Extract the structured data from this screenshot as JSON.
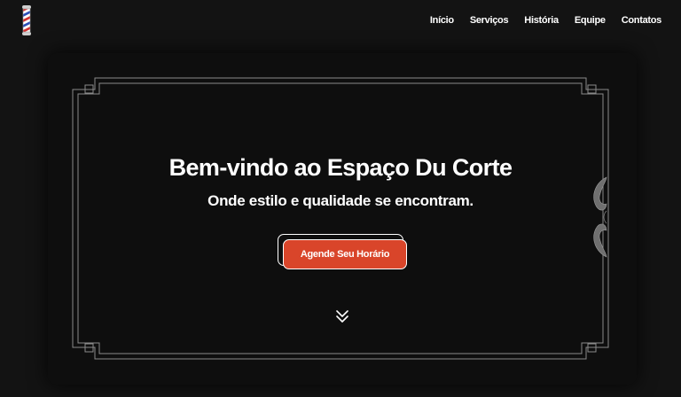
{
  "nav": {
    "logo_icon": "barber-pole-icon",
    "links": [
      {
        "label": "Início"
      },
      {
        "label": "Serviços"
      },
      {
        "label": "História"
      },
      {
        "label": "Equipe"
      },
      {
        "label": "Contatos"
      }
    ]
  },
  "hero": {
    "title": "Bem-vindo ao Espaço Du Corte",
    "subtitle": "Onde estilo e qualidade se encontram.",
    "cta_label": "Agende Seu Horário",
    "scroll_icon": "double-chevron-down-icon",
    "decoration_icon": "mustache-icon"
  },
  "colors": {
    "background": "#131313",
    "panel": "#0e0e0e",
    "frame_lines": "#8a8a8a",
    "cta": "#d9452a",
    "text": "#ffffff"
  }
}
